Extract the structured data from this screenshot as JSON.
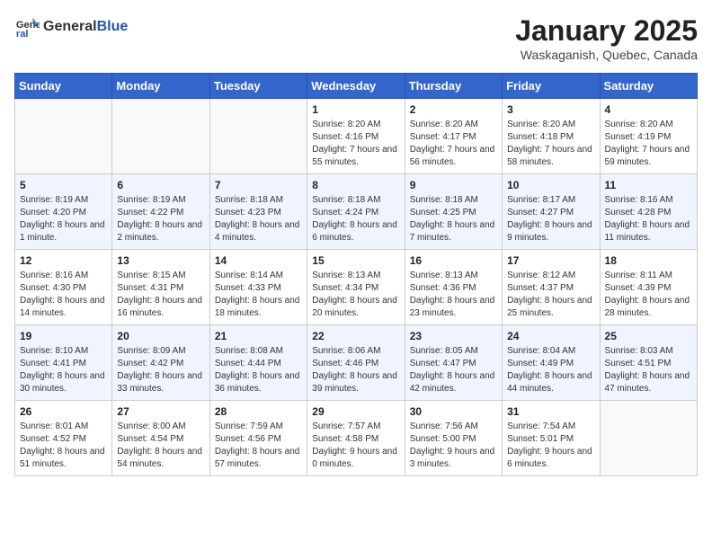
{
  "header": {
    "logo_general": "General",
    "logo_blue": "Blue",
    "title": "January 2025",
    "subtitle": "Waskaganish, Quebec, Canada"
  },
  "days_of_week": [
    "Sunday",
    "Monday",
    "Tuesday",
    "Wednesday",
    "Thursday",
    "Friday",
    "Saturday"
  ],
  "weeks": [
    [
      {
        "day": "",
        "sunrise": "",
        "sunset": "",
        "daylight": ""
      },
      {
        "day": "",
        "sunrise": "",
        "sunset": "",
        "daylight": ""
      },
      {
        "day": "",
        "sunrise": "",
        "sunset": "",
        "daylight": ""
      },
      {
        "day": "1",
        "sunrise": "Sunrise: 8:20 AM",
        "sunset": "Sunset: 4:16 PM",
        "daylight": "Daylight: 7 hours and 55 minutes."
      },
      {
        "day": "2",
        "sunrise": "Sunrise: 8:20 AM",
        "sunset": "Sunset: 4:17 PM",
        "daylight": "Daylight: 7 hours and 56 minutes."
      },
      {
        "day": "3",
        "sunrise": "Sunrise: 8:20 AM",
        "sunset": "Sunset: 4:18 PM",
        "daylight": "Daylight: 7 hours and 58 minutes."
      },
      {
        "day": "4",
        "sunrise": "Sunrise: 8:20 AM",
        "sunset": "Sunset: 4:19 PM",
        "daylight": "Daylight: 7 hours and 59 minutes."
      }
    ],
    [
      {
        "day": "5",
        "sunrise": "Sunrise: 8:19 AM",
        "sunset": "Sunset: 4:20 PM",
        "daylight": "Daylight: 8 hours and 1 minute."
      },
      {
        "day": "6",
        "sunrise": "Sunrise: 8:19 AM",
        "sunset": "Sunset: 4:22 PM",
        "daylight": "Daylight: 8 hours and 2 minutes."
      },
      {
        "day": "7",
        "sunrise": "Sunrise: 8:18 AM",
        "sunset": "Sunset: 4:23 PM",
        "daylight": "Daylight: 8 hours and 4 minutes."
      },
      {
        "day": "8",
        "sunrise": "Sunrise: 8:18 AM",
        "sunset": "Sunset: 4:24 PM",
        "daylight": "Daylight: 8 hours and 6 minutes."
      },
      {
        "day": "9",
        "sunrise": "Sunrise: 8:18 AM",
        "sunset": "Sunset: 4:25 PM",
        "daylight": "Daylight: 8 hours and 7 minutes."
      },
      {
        "day": "10",
        "sunrise": "Sunrise: 8:17 AM",
        "sunset": "Sunset: 4:27 PM",
        "daylight": "Daylight: 8 hours and 9 minutes."
      },
      {
        "day": "11",
        "sunrise": "Sunrise: 8:16 AM",
        "sunset": "Sunset: 4:28 PM",
        "daylight": "Daylight: 8 hours and 11 minutes."
      }
    ],
    [
      {
        "day": "12",
        "sunrise": "Sunrise: 8:16 AM",
        "sunset": "Sunset: 4:30 PM",
        "daylight": "Daylight: 8 hours and 14 minutes."
      },
      {
        "day": "13",
        "sunrise": "Sunrise: 8:15 AM",
        "sunset": "Sunset: 4:31 PM",
        "daylight": "Daylight: 8 hours and 16 minutes."
      },
      {
        "day": "14",
        "sunrise": "Sunrise: 8:14 AM",
        "sunset": "Sunset: 4:33 PM",
        "daylight": "Daylight: 8 hours and 18 minutes."
      },
      {
        "day": "15",
        "sunrise": "Sunrise: 8:13 AM",
        "sunset": "Sunset: 4:34 PM",
        "daylight": "Daylight: 8 hours and 20 minutes."
      },
      {
        "day": "16",
        "sunrise": "Sunrise: 8:13 AM",
        "sunset": "Sunset: 4:36 PM",
        "daylight": "Daylight: 8 hours and 23 minutes."
      },
      {
        "day": "17",
        "sunrise": "Sunrise: 8:12 AM",
        "sunset": "Sunset: 4:37 PM",
        "daylight": "Daylight: 8 hours and 25 minutes."
      },
      {
        "day": "18",
        "sunrise": "Sunrise: 8:11 AM",
        "sunset": "Sunset: 4:39 PM",
        "daylight": "Daylight: 8 hours and 28 minutes."
      }
    ],
    [
      {
        "day": "19",
        "sunrise": "Sunrise: 8:10 AM",
        "sunset": "Sunset: 4:41 PM",
        "daylight": "Daylight: 8 hours and 30 minutes."
      },
      {
        "day": "20",
        "sunrise": "Sunrise: 8:09 AM",
        "sunset": "Sunset: 4:42 PM",
        "daylight": "Daylight: 8 hours and 33 minutes."
      },
      {
        "day": "21",
        "sunrise": "Sunrise: 8:08 AM",
        "sunset": "Sunset: 4:44 PM",
        "daylight": "Daylight: 8 hours and 36 minutes."
      },
      {
        "day": "22",
        "sunrise": "Sunrise: 8:06 AM",
        "sunset": "Sunset: 4:46 PM",
        "daylight": "Daylight: 8 hours and 39 minutes."
      },
      {
        "day": "23",
        "sunrise": "Sunrise: 8:05 AM",
        "sunset": "Sunset: 4:47 PM",
        "daylight": "Daylight: 8 hours and 42 minutes."
      },
      {
        "day": "24",
        "sunrise": "Sunrise: 8:04 AM",
        "sunset": "Sunset: 4:49 PM",
        "daylight": "Daylight: 8 hours and 44 minutes."
      },
      {
        "day": "25",
        "sunrise": "Sunrise: 8:03 AM",
        "sunset": "Sunset: 4:51 PM",
        "daylight": "Daylight: 8 hours and 47 minutes."
      }
    ],
    [
      {
        "day": "26",
        "sunrise": "Sunrise: 8:01 AM",
        "sunset": "Sunset: 4:52 PM",
        "daylight": "Daylight: 8 hours and 51 minutes."
      },
      {
        "day": "27",
        "sunrise": "Sunrise: 8:00 AM",
        "sunset": "Sunset: 4:54 PM",
        "daylight": "Daylight: 8 hours and 54 minutes."
      },
      {
        "day": "28",
        "sunrise": "Sunrise: 7:59 AM",
        "sunset": "Sunset: 4:56 PM",
        "daylight": "Daylight: 8 hours and 57 minutes."
      },
      {
        "day": "29",
        "sunrise": "Sunrise: 7:57 AM",
        "sunset": "Sunset: 4:58 PM",
        "daylight": "Daylight: 9 hours and 0 minutes."
      },
      {
        "day": "30",
        "sunrise": "Sunrise: 7:56 AM",
        "sunset": "Sunset: 5:00 PM",
        "daylight": "Daylight: 9 hours and 3 minutes."
      },
      {
        "day": "31",
        "sunrise": "Sunrise: 7:54 AM",
        "sunset": "Sunset: 5:01 PM",
        "daylight": "Daylight: 9 hours and 6 minutes."
      },
      {
        "day": "",
        "sunrise": "",
        "sunset": "",
        "daylight": ""
      }
    ]
  ]
}
